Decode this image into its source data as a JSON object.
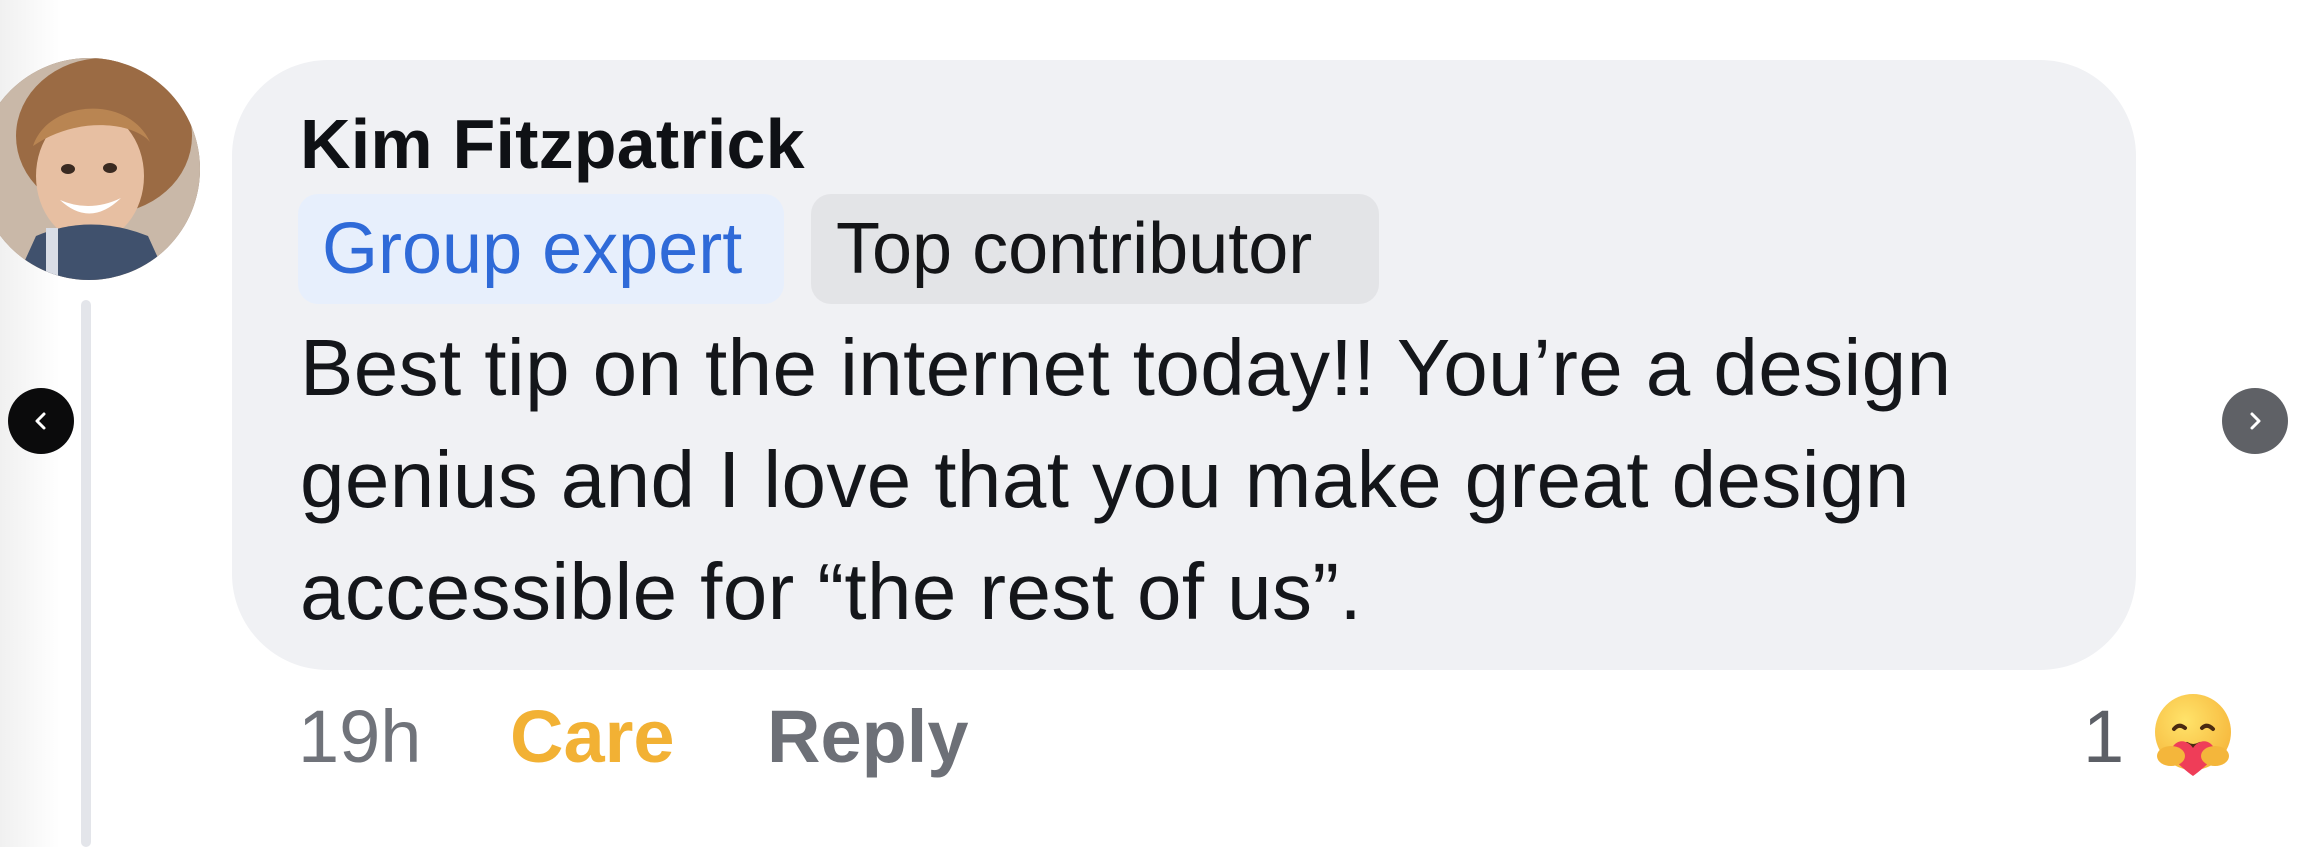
{
  "comment": {
    "author": "Kim Fitzpatrick",
    "badges": [
      {
        "label": "Group expert",
        "color": "#2f6ad8"
      },
      {
        "label": "Top contributor",
        "color": "#141518"
      }
    ],
    "text_lines": [
      "Best tip on the internet today!! You’re a design",
      "genius and I love that you make great design",
      "accessible for “the rest of us”."
    ],
    "timestamp": "19h",
    "reaction_label": "Care",
    "reaction_color": "#f2b134",
    "reply_label": "Reply",
    "reaction_count": "1",
    "reaction_icon": "care-emoji-icon"
  },
  "navigation": {
    "prev_icon": "chevron-left-icon",
    "next_icon": "chevron-right-icon"
  }
}
